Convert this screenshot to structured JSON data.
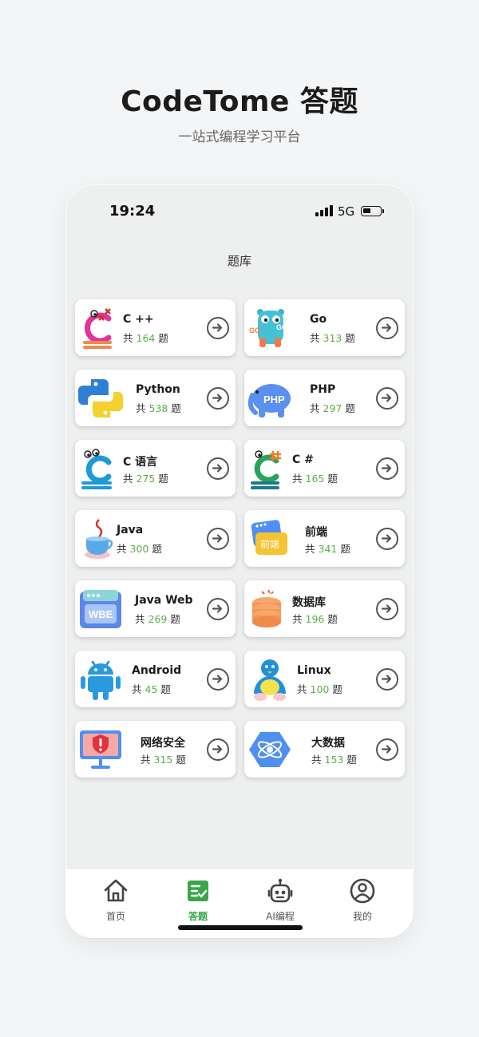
{
  "hero": {
    "title": "CodeTome 答题",
    "subtitle": "一站式编程学习平台"
  },
  "status": {
    "time": "19:24",
    "network": "5G"
  },
  "page": {
    "title": "题库"
  },
  "count_prefix": "共",
  "count_suffix": "题",
  "accent_color": "#5cae4a",
  "tab_active_color": "#3aa54a",
  "categories": [
    {
      "name": "C ++",
      "count": "164",
      "icon": "cpp-logo-icon"
    },
    {
      "name": "Go",
      "count": "313",
      "icon": "go-gopher-icon"
    },
    {
      "name": "Python",
      "count": "538",
      "icon": "python-logo-icon"
    },
    {
      "name": "PHP",
      "count": "297",
      "icon": "php-elephant-icon"
    },
    {
      "name": "C 语言",
      "count": "275",
      "icon": "c-language-icon"
    },
    {
      "name": "C #",
      "count": "165",
      "icon": "csharp-logo-icon"
    },
    {
      "name": "Java",
      "count": "300",
      "icon": "java-cup-icon"
    },
    {
      "name": "前端",
      "count": "341",
      "icon": "frontend-icon"
    },
    {
      "name": "Java Web",
      "count": "269",
      "icon": "java-web-icon"
    },
    {
      "name": "数据库",
      "count": "196",
      "icon": "database-icon"
    },
    {
      "name": "Android",
      "count": "45",
      "icon": "android-robot-icon"
    },
    {
      "name": "Linux",
      "count": "100",
      "icon": "linux-penguin-icon"
    },
    {
      "name": "网络安全",
      "count": "315",
      "icon": "network-security-icon"
    },
    {
      "name": "大数据",
      "count": "153",
      "icon": "big-data-icon"
    }
  ],
  "icon_text": {
    "php": "PHP",
    "frontend": "前端",
    "web": "WBE"
  },
  "tabs": [
    {
      "label": "首页",
      "icon": "home-icon"
    },
    {
      "label": "答题",
      "icon": "quiz-icon",
      "active": true
    },
    {
      "label": "AI编程",
      "icon": "robot-icon"
    },
    {
      "label": "我的",
      "icon": "profile-icon"
    }
  ]
}
